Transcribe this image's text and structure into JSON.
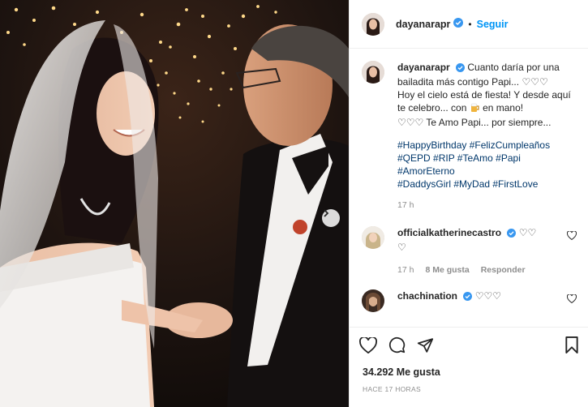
{
  "post": {
    "image_alt": "Bride in veil laughing with her father in a tuxedo under string lights",
    "author": "dayanarapr",
    "follow_label": "Seguir",
    "separator": "•",
    "caption": {
      "username": "dayanarapr",
      "line1": "Cuanto daría por una bailadita más contigo Papi...",
      "line2": "Hoy el cielo está de fiesta! Y desde aquí te celebro... con",
      "line2b": "en mano!",
      "line3": "Te Amo Papi... por siempre...",
      "hashtags": [
        "#HappyBirthday #FelizCumpleaños",
        "#QEPD #RIP #TeAmo #Papi",
        "#AmorEterno",
        "#DaddysGirl #MyDad #FirstLove"
      ],
      "time": "17 h"
    },
    "comments": [
      {
        "username": "officialkatherinecastro",
        "time": "17 h",
        "likes": "8 Me gusta",
        "reply": "Responder"
      },
      {
        "username": "chachination"
      }
    ],
    "likes": "34.292 Me gusta",
    "date": "HACE 17 HORAS"
  },
  "colors": {
    "link": "#00376b",
    "accent": "#0095f6",
    "muted": "#8e8e8e",
    "verified": "#3897f0"
  },
  "icons": [
    "heart-icon",
    "comment-icon",
    "share-icon",
    "bookmark-icon",
    "chevron-right-icon",
    "verified-badge-icon"
  ]
}
